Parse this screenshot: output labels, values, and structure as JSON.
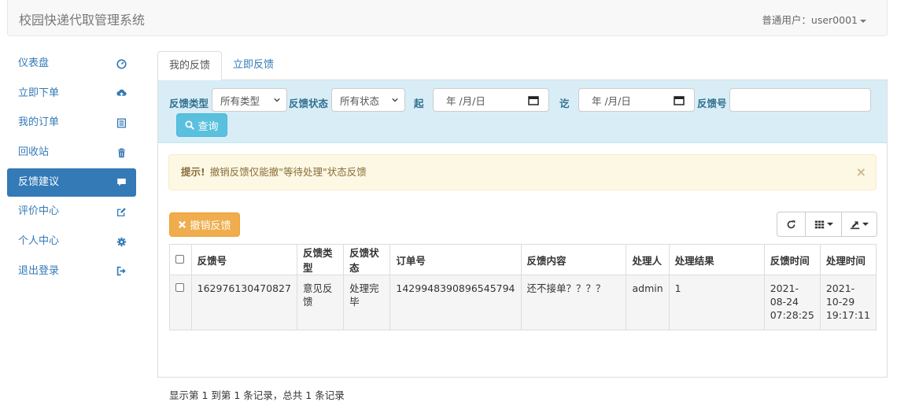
{
  "app": {
    "title": "校园快递代取管理系统",
    "user": "普通用户：user0001"
  },
  "sidebar": {
    "items": [
      {
        "label": "仪表盘",
        "icon": "dashboard-icon"
      },
      {
        "label": "立即下单",
        "icon": "cloud-upload-icon"
      },
      {
        "label": "我的订单",
        "icon": "list-alt-icon"
      },
      {
        "label": "回收站",
        "icon": "trash-icon"
      },
      {
        "label": "反馈建议",
        "icon": "comment-icon",
        "active": true
      },
      {
        "label": "评价中心",
        "icon": "edit-icon"
      },
      {
        "label": "个人中心",
        "icon": "cog-icon"
      },
      {
        "label": "退出登录",
        "icon": "logout-icon"
      }
    ]
  },
  "tabs": [
    {
      "label": "我的反馈",
      "active": true
    },
    {
      "label": "立即反馈"
    }
  ],
  "filters": {
    "type_label": "反馈类型",
    "type_value": "所有类型",
    "status_label": "反馈状态",
    "status_value": "所有状态",
    "from_label": "起",
    "from_value": "年 /月/日",
    "to_label": "讫",
    "to_value": "年 /月/日",
    "id_label": "反馈号",
    "id_value": "",
    "query_button": "查询"
  },
  "alert": {
    "title": "提示!",
    "message": "撤销反馈仅能撤\"等待处理\"状态反馈",
    "close": "×"
  },
  "toolbar": {
    "cancel_button": "撤销反馈"
  },
  "table": {
    "headers": [
      "反馈号",
      "反馈类型",
      "反馈状态",
      "订单号",
      "反馈内容",
      "处理人",
      "处理结果",
      "反馈时间",
      "处理时间"
    ],
    "rows": [
      {
        "id": "162976130470827",
        "type": "意见反馈",
        "status": "处理完毕",
        "order_no": "1429948390896545794",
        "content": "还不接单？？？？",
        "handler": "admin",
        "result": "1",
        "feedback_time": [
          "2021-",
          "08-24",
          "07:28:25"
        ],
        "handle_time": [
          "2021-",
          "10-29",
          "19:17:11"
        ]
      }
    ]
  },
  "pager": {
    "info": "显示第 1 到第 1 条记录，总共 1 条记录"
  },
  "colors": {
    "primary": "#337ab7",
    "info": "#5bc0de",
    "warning": "#f0ad4e",
    "success_text": "#3c9c3c"
  }
}
